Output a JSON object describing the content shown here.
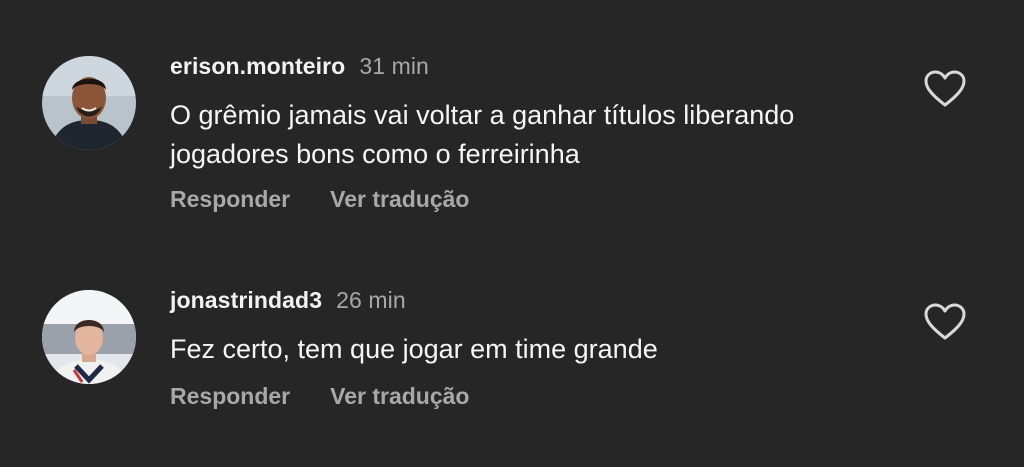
{
  "comments": [
    {
      "username": "erison.monteiro",
      "time": "31 min",
      "text": "O grêmio jamais vai voltar a ganhar títulos liberando jogadores bons como o ferreirinha",
      "reply_label": "Responder",
      "translate_label": "Ver tradução",
      "like_icon": "heart-outline-icon"
    },
    {
      "username": "jonastrindad3",
      "time": "26 min",
      "text": "Fez certo, tem que jogar em time grande",
      "reply_label": "Responder",
      "translate_label": "Ver tradução",
      "like_icon": "heart-outline-icon"
    }
  ],
  "colors": {
    "background": "#262626",
    "primary_text": "#f5f5f5",
    "secondary_text": "#a8a8a8"
  }
}
